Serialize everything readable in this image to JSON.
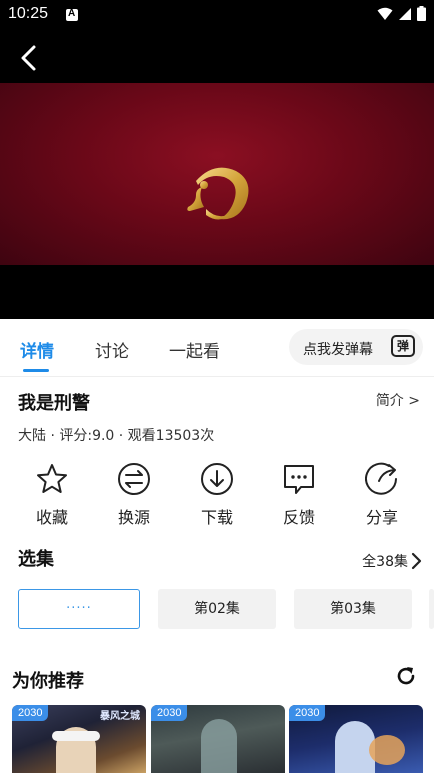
{
  "status_bar": {
    "time": "10:25"
  },
  "tabs": [
    {
      "label": "详情",
      "active": true
    },
    {
      "label": "讨论",
      "active": false
    },
    {
      "label": "一起看",
      "active": false
    }
  ],
  "danmu": {
    "label": "点我发弹幕",
    "icon_text": "弹"
  },
  "info": {
    "title": "我是刑警",
    "intro_label": "简介 >",
    "meta": "大陆 · 评分:9.0 · 观看13503次"
  },
  "actions": [
    {
      "label": "收藏",
      "icon": "star-icon"
    },
    {
      "label": "换源",
      "icon": "switch-source-icon"
    },
    {
      "label": "下载",
      "icon": "download-icon"
    },
    {
      "label": "反馈",
      "icon": "feedback-icon"
    },
    {
      "label": "分享",
      "icon": "share-icon"
    }
  ],
  "episodes": {
    "title": "选集",
    "all_label": "全38集",
    "items": [
      {
        "label": "·····"
      },
      {
        "label": "第02集"
      },
      {
        "label": "第03集"
      }
    ]
  },
  "recommend": {
    "title": "为你推荐",
    "items": [
      {
        "badge": "2030",
        "poster_text": "暴风之城"
      },
      {
        "badge": "2030",
        "poster_text": ""
      },
      {
        "badge": "2030",
        "poster_text": ""
      }
    ]
  },
  "colors": {
    "accent": "#1e8be8",
    "video_red": "#6a0818",
    "badge_blue": "#3b8ee8"
  }
}
